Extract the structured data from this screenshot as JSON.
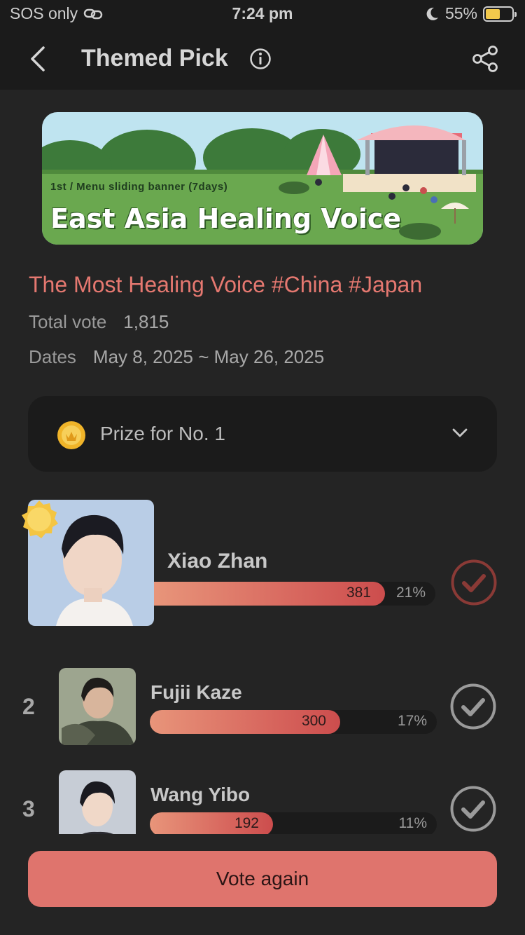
{
  "status_bar": {
    "carrier": "SOS only",
    "time": "7:24 pm",
    "battery_pct": "55%",
    "battery_level": 0.55
  },
  "header": {
    "title": "Themed Pick",
    "back_icon": "chevron-left-icon",
    "info_icon": "info-icon",
    "share_icon": "share-icon"
  },
  "banner": {
    "tag": "1st / Menu sliding banner (7days)",
    "title": "East Asia Healing Voice"
  },
  "poll": {
    "title": "The Most Healing Voice #China #Japan",
    "total_label": "Total vote",
    "total_value": "1,815",
    "dates_label": "Dates",
    "dates_value": "May 8, 2025 ~ May 26, 2025"
  },
  "prize": {
    "label": "Prize for No. 1",
    "icon": "coin-icon",
    "toggle_icon": "chevron-down-icon"
  },
  "candidates": [
    {
      "rank": "1",
      "name": "Xiao Zhan",
      "votes": "381",
      "percent": "21%",
      "share": 0.21,
      "selected": true
    },
    {
      "rank": "2",
      "name": "Fujii Kaze",
      "votes": "300",
      "percent": "17%",
      "share": 0.17,
      "selected": false
    },
    {
      "rank": "3",
      "name": "Wang Yibo",
      "votes": "192",
      "percent": "11%",
      "share": 0.11,
      "selected": false
    }
  ],
  "actions": {
    "vote_again": "Vote again"
  },
  "colors": {
    "accent": "#df746d",
    "title_red": "#e57870",
    "background": "#242424",
    "panel": "#1b1b1b"
  }
}
